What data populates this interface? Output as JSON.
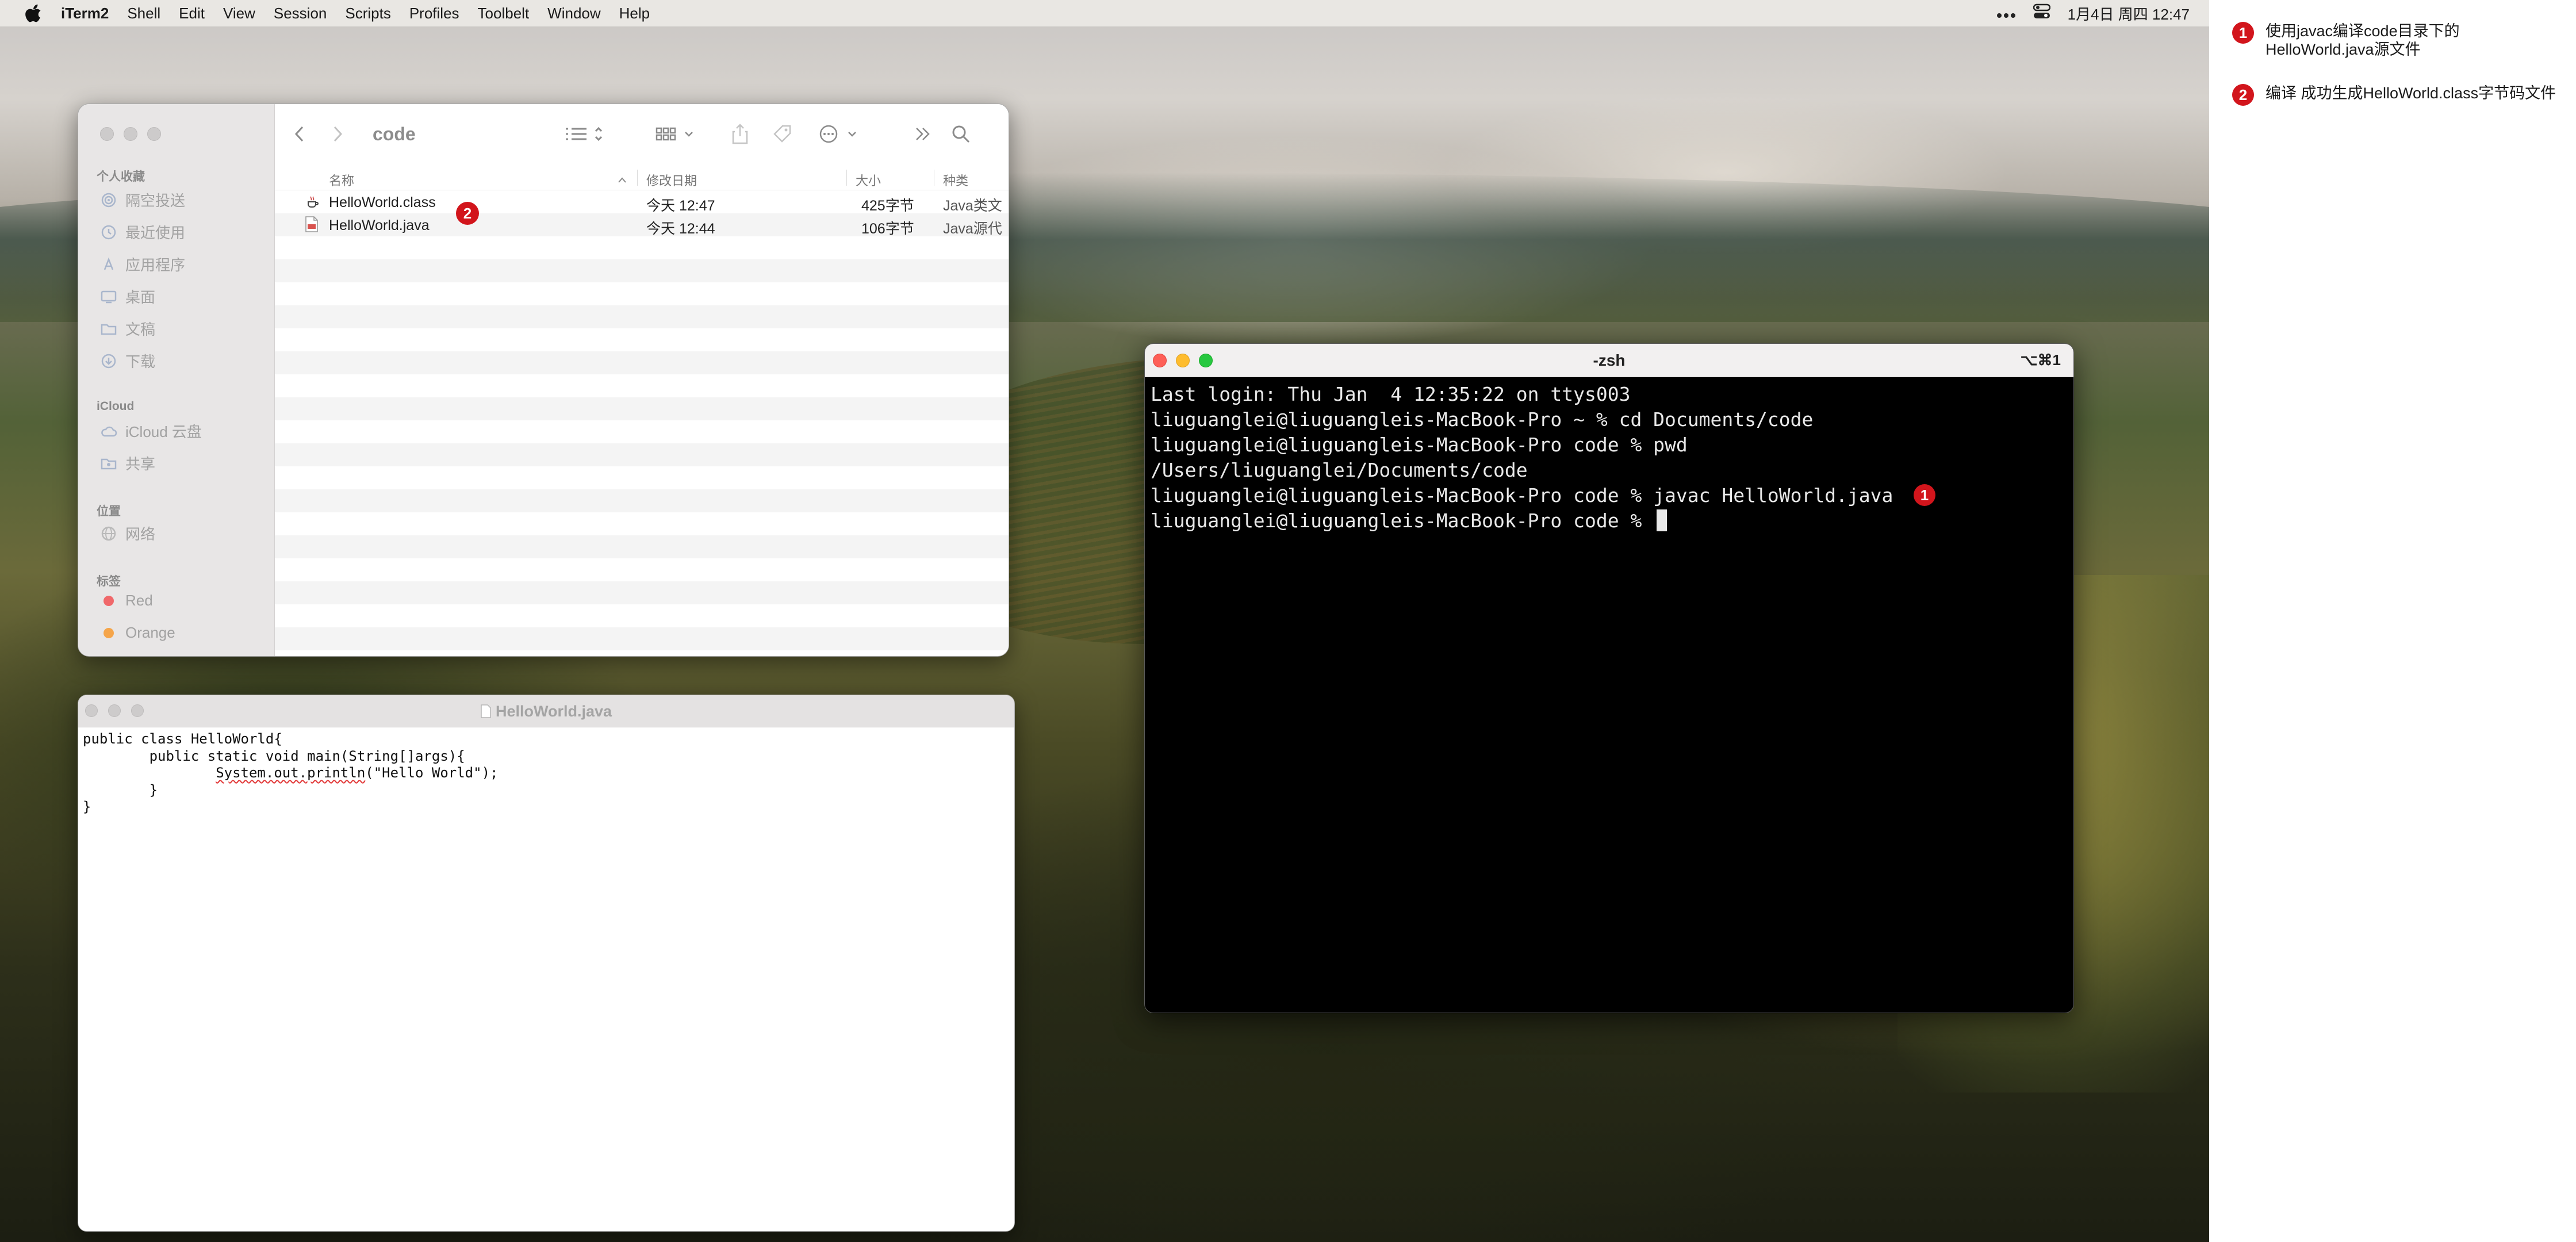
{
  "menubar": {
    "app_name": "iTerm2",
    "items": [
      "Shell",
      "Edit",
      "View",
      "Session",
      "Scripts",
      "Profiles",
      "Toolbelt",
      "Window",
      "Help"
    ],
    "clock": "1月4日 周四 12:47",
    "icons": [
      "apple-icon",
      "more-icon",
      "control-center-icon"
    ]
  },
  "notes": [
    {
      "num": "1",
      "text": "使用javac编译code目录下的HelloWorld.java源文件"
    },
    {
      "num": "2",
      "text": "编译 成功生成HelloWorld.class字节码文件"
    }
  ],
  "finder": {
    "title": "code",
    "sidebar": {
      "favorites_label": "个人收藏",
      "favorites": [
        {
          "label": "隔空投送",
          "icon": "airdrop-icon"
        },
        {
          "label": "最近使用",
          "icon": "clock-icon"
        },
        {
          "label": "应用程序",
          "icon": "applications-icon"
        },
        {
          "label": "桌面",
          "icon": "desktop-icon"
        },
        {
          "label": "文稿",
          "icon": "folder-icon"
        },
        {
          "label": "下载",
          "icon": "download-icon"
        }
      ],
      "icloud_label": "iCloud",
      "icloud": [
        {
          "label": "iCloud 云盘",
          "icon": "cloud-icon"
        },
        {
          "label": "共享",
          "icon": "shared-folder-icon"
        }
      ],
      "locations_label": "位置",
      "locations": [
        {
          "label": "网络",
          "icon": "network-icon"
        }
      ],
      "tags_label": "标签",
      "tags": [
        {
          "label": "Red",
          "color": "#f0686a"
        },
        {
          "label": "Orange",
          "color": "#f5a54a"
        }
      ]
    },
    "columns": {
      "name": "名称",
      "date": "修改日期",
      "size": "大小",
      "kind": "种类"
    },
    "files": [
      {
        "name": "HelloWorld.class",
        "date": "今天 12:47",
        "size": "425字节",
        "kind": "Java类文",
        "badge": "2",
        "icon": "java-class-icon"
      },
      {
        "name": "HelloWorld.java",
        "date": "今天 12:44",
        "size": "106字节",
        "kind": "Java源代",
        "icon": "java-source-icon"
      }
    ]
  },
  "textedit": {
    "title": "HelloWorld.java",
    "lines": [
      "public class HelloWorld{",
      "        public static void main(String[]args){",
      "                ",
      "        }",
      "}"
    ],
    "println_prefix": "System.out.println",
    "println_suffix": "(\"Hello World\");"
  },
  "terminal": {
    "title": "-zsh",
    "shortcut": "⌥⌘1",
    "lines": [
      "Last login: Thu Jan  4 12:35:22 on ttys003",
      "liuguanglei@liuguangleis-MacBook-Pro ~ % cd Documents/code",
      "liuguanglei@liuguangleis-MacBook-Pro code % pwd",
      "/Users/liuguanglei/Documents/code",
      "liuguanglei@liuguangleis-MacBook-Pro code % javac HelloWorld.java",
      "liuguanglei@liuguangleis-MacBook-Pro code % "
    ],
    "badge": "1"
  }
}
